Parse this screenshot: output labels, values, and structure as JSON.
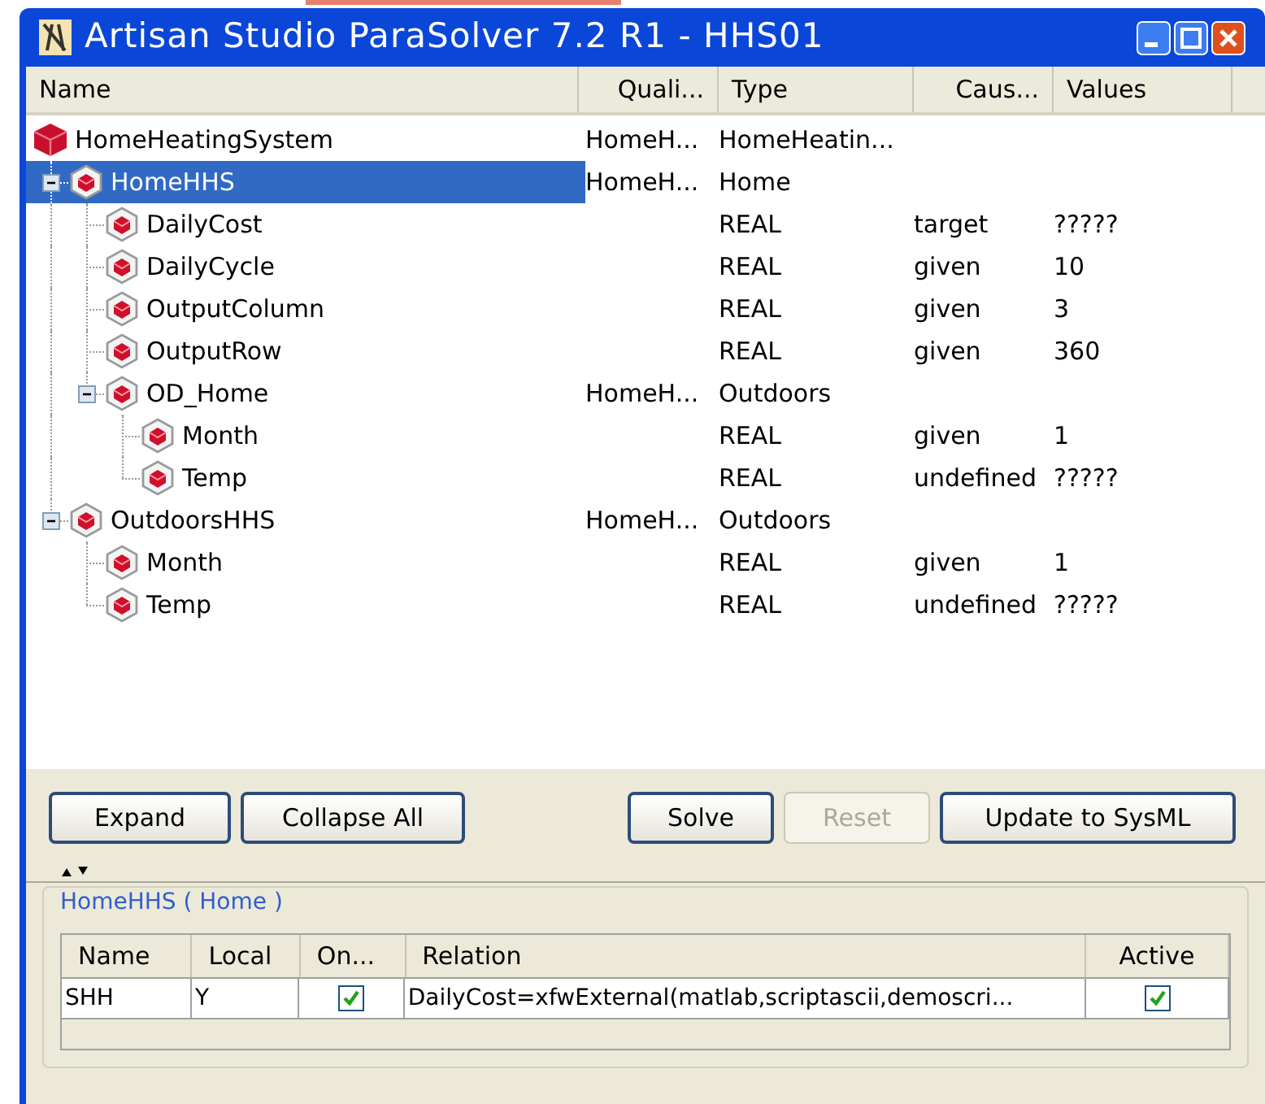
{
  "window": {
    "title": "Artisan Studio ParaSolver 7.2 R1 - HHS01"
  },
  "tree": {
    "columns": [
      "Name",
      "Quali...",
      "Type",
      "Caus...",
      "Values"
    ],
    "nodes": [
      {
        "name": "HomeHeatingSystem",
        "kind": "system",
        "selected": false,
        "qualifier": "HomeH...",
        "type": "HomeHeatin...",
        "children": [
          {
            "name": "HomeHHS",
            "kind": "part",
            "selected": true,
            "expanded": true,
            "qualifier": "HomeH...",
            "type": "Home",
            "children": [
              {
                "name": "DailyCost",
                "kind": "part",
                "selected": false,
                "type": "REAL",
                "causality": "target",
                "value": "?????"
              },
              {
                "name": "DailyCycle",
                "kind": "part",
                "selected": false,
                "type": "REAL",
                "causality": "given",
                "value": "10"
              },
              {
                "name": "OutputColumn",
                "kind": "part",
                "selected": false,
                "type": "REAL",
                "causality": "given",
                "value": "3"
              },
              {
                "name": "OutputRow",
                "kind": "part",
                "selected": false,
                "type": "REAL",
                "causality": "given",
                "value": "360"
              },
              {
                "name": "OD_Home",
                "kind": "part",
                "selected": false,
                "expanded": true,
                "qualifier": "HomeH...",
                "type": "Outdoors",
                "children": [
                  {
                    "name": "Month",
                    "kind": "part",
                    "selected": false,
                    "type": "REAL",
                    "causality": "given",
                    "value": "1"
                  },
                  {
                    "name": "Temp",
                    "kind": "part",
                    "selected": false,
                    "type": "REAL",
                    "causality": "undefined",
                    "value": "?????"
                  }
                ]
              }
            ]
          },
          {
            "name": "OutdoorsHHS",
            "kind": "part",
            "selected": false,
            "expanded": true,
            "qualifier": "HomeH...",
            "type": "Outdoors",
            "children": [
              {
                "name": "Month",
                "kind": "part",
                "selected": false,
                "type": "REAL",
                "causality": "given",
                "value": "1"
              },
              {
                "name": "Temp",
                "kind": "part",
                "selected": false,
                "type": "REAL",
                "causality": "undefined",
                "value": "?????"
              }
            ]
          }
        ]
      }
    ]
  },
  "buttons": [
    {
      "label": "Expand",
      "disabled": false
    },
    {
      "label": "Collapse All",
      "disabled": false
    },
    {
      "label": "Solve",
      "disabled": false
    },
    {
      "label": "Reset",
      "disabled": true
    },
    {
      "label": "Update to SysML",
      "disabled": false
    }
  ],
  "relations": {
    "title": "HomeHHS ( Home )",
    "columns": [
      "Name",
      "Local",
      "On...",
      "Relation",
      "Active"
    ],
    "rows": [
      {
        "name": "SHH",
        "local": "Y",
        "on": true,
        "relation": "DailyCost=xfwExternal(matlab,scriptascii,demoscri...",
        "active": true
      }
    ]
  }
}
